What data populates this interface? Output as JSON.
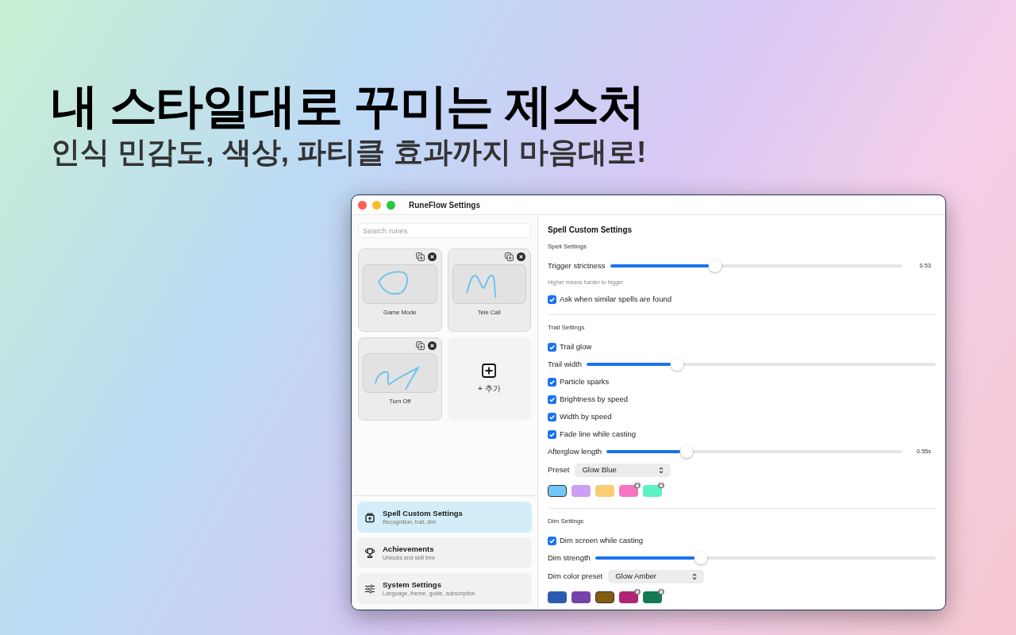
{
  "headline": "내 스타일대로 꾸미는 제스처",
  "subheadline": "인식 민감도, 색상, 파티클 효과까지 마음대로!",
  "window": {
    "title": "RuneFlow Settings"
  },
  "search": {
    "placeholder": "Search runes"
  },
  "runes": [
    {
      "name": "Game Mode",
      "kind": "loop"
    },
    {
      "name": "Tele Call",
      "kind": "peaks"
    },
    {
      "name": "Turn Off",
      "kind": "zigzag"
    }
  ],
  "add_card": {
    "label": "+ 추가"
  },
  "nav": [
    {
      "title": "Spell Custom Settings",
      "subtitle": "Recognition, trail, dim",
      "selected": true
    },
    {
      "title": "Achievements",
      "subtitle": "Unlocks and skill tree",
      "selected": false
    },
    {
      "title": "System Settings",
      "subtitle": "Language, theme, guide, subscription",
      "selected": false
    }
  ],
  "panel": {
    "title": "Spell Custom Settings",
    "sections": [
      {
        "title": "Spell Settings",
        "rows": [
          {
            "kind": "slider",
            "label": "Trigger strictness",
            "level": 0.36,
            "reading": "0.53"
          },
          {
            "kind": "hint",
            "label": "Higher means harder to trigger"
          },
          {
            "kind": "checkbox",
            "label": "Ask when similar spells are found",
            "checked": true
          }
        ]
      },
      {
        "title": "Trail Settings",
        "rows": [
          {
            "kind": "checkbox",
            "label": "Trail glow",
            "checked": true
          },
          {
            "kind": "slider",
            "label": "Trail width",
            "level": 0.26
          },
          {
            "kind": "checkbox",
            "label": "Particle sparks",
            "checked": true
          },
          {
            "kind": "checkbox",
            "label": "Brightness by speed",
            "checked": true
          },
          {
            "kind": "checkbox",
            "label": "Width by speed",
            "checked": true
          },
          {
            "kind": "checkbox",
            "label": "Fade line while casting",
            "checked": true
          },
          {
            "kind": "slider",
            "label": "Afterglow length",
            "level": 0.27,
            "reading": "0.55s"
          },
          {
            "kind": "select",
            "label": "Preset",
            "value": "Glow Blue"
          },
          {
            "kind": "swatches",
            "swatches": [
              {
                "color": "#74c8f7",
                "selected": true,
                "locked": false
              },
              {
                "color": "#cc9ef5",
                "selected": false,
                "locked": false
              },
              {
                "color": "#f9cd70",
                "selected": false,
                "locked": false
              },
              {
                "color": "#f774bf",
                "selected": false,
                "locked": true
              },
              {
                "color": "#5cf2c4",
                "selected": false,
                "locked": true
              }
            ]
          }
        ]
      },
      {
        "title": "Dim Settings",
        "rows": [
          {
            "kind": "checkbox",
            "label": "Dim screen while casting",
            "checked": true
          },
          {
            "kind": "slider",
            "label": "Dim strength",
            "level": 0.31
          },
          {
            "kind": "select",
            "label": "Dim color preset",
            "value": "Glow Amber"
          },
          {
            "kind": "swatches",
            "swatches": [
              {
                "color": "#2c5cb0",
                "selected": false,
                "locked": false
              },
              {
                "color": "#7444a8",
                "selected": false,
                "locked": false
              },
              {
                "color": "#835c12",
                "selected": true,
                "locked": false
              },
              {
                "color": "#b02474",
                "selected": false,
                "locked": true
              },
              {
                "color": "#137a54",
                "selected": false,
                "locked": true
              }
            ]
          }
        ]
      }
    ]
  }
}
